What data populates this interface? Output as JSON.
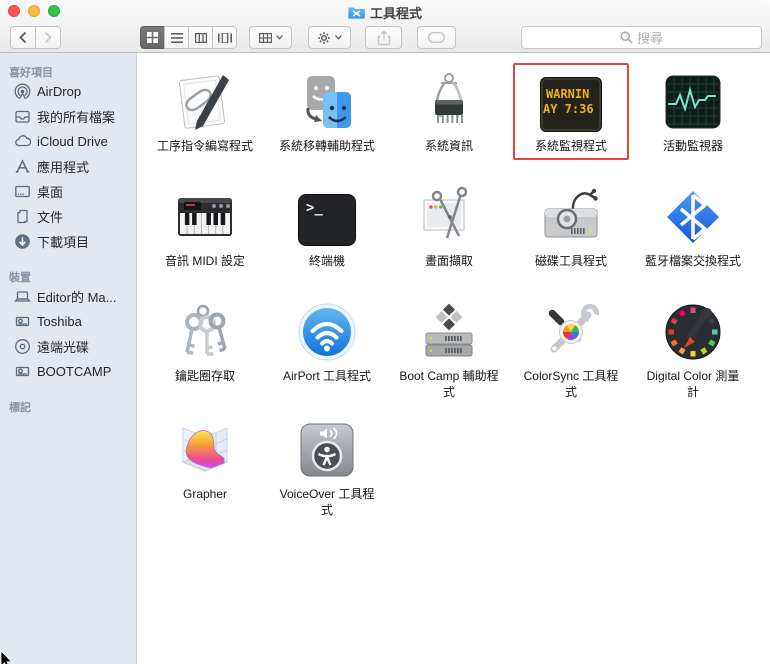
{
  "window": {
    "title": "工具程式"
  },
  "toolbar": {
    "search_placeholder": "搜尋",
    "icons": [
      "back-icon",
      "forward-icon",
      "icon-view-icon",
      "list-view-icon",
      "column-view-icon",
      "coverflow-view-icon",
      "arrange-icon",
      "gear-icon",
      "share-icon",
      "tag-icon",
      "search-icon"
    ]
  },
  "sidebar": {
    "sections": [
      {
        "header": "喜好項目",
        "items": [
          {
            "label": "AirDrop",
            "icon": "airdrop-icon"
          },
          {
            "label": "我的所有檔案",
            "icon": "all-files-icon"
          },
          {
            "label": "iCloud Drive",
            "icon": "icloud-icon"
          },
          {
            "label": "應用程式",
            "icon": "applications-icon"
          },
          {
            "label": "桌面",
            "icon": "desktop-icon"
          },
          {
            "label": "文件",
            "icon": "documents-icon"
          },
          {
            "label": "下載項目",
            "icon": "downloads-icon"
          }
        ]
      },
      {
        "header": "裝置",
        "items": [
          {
            "label": "Editor的 Ma...",
            "icon": "laptop-icon"
          },
          {
            "label": "Toshiba",
            "icon": "external-drive-icon"
          },
          {
            "label": "遠端光碟",
            "icon": "optical-disc-icon"
          },
          {
            "label": "BOOTCAMP",
            "icon": "external-drive-icon"
          }
        ]
      },
      {
        "header": "標記",
        "items": []
      }
    ]
  },
  "grid": {
    "items": [
      {
        "label": "工序指令編寫程式",
        "icon": "script-editor-icon"
      },
      {
        "label": "系統移轉輔助程式",
        "icon": "migration-assistant-icon"
      },
      {
        "label": "系統資訊",
        "icon": "system-information-icon"
      },
      {
        "label": "系統監視程式",
        "icon": "system-monitor-icon",
        "highlighted": true
      },
      {
        "label": "活動監視器",
        "icon": "activity-monitor-icon"
      },
      {
        "label": "音訊 MIDI 設定",
        "icon": "audio-midi-setup-icon"
      },
      {
        "label": "終端機",
        "icon": "terminal-icon"
      },
      {
        "label": "畫面擷取",
        "icon": "grab-icon"
      },
      {
        "label": "磁碟工具程式",
        "icon": "disk-utility-icon"
      },
      {
        "label": "藍牙檔案交換程式",
        "icon": "bluetooth-file-exchange-icon"
      },
      {
        "label": "鑰匙圈存取",
        "icon": "keychain-access-icon"
      },
      {
        "label": "AirPort 工具程式",
        "icon": "airport-utility-icon"
      },
      {
        "label": "Boot Camp 輔助程式",
        "icon": "boot-camp-assistant-icon"
      },
      {
        "label": "ColorSync 工具程式",
        "icon": "colorsync-utility-icon"
      },
      {
        "label": "Digital Color 測量計",
        "icon": "digital-color-meter-icon"
      },
      {
        "label": "Grapher",
        "icon": "grapher-icon"
      },
      {
        "label": "VoiceOver 工具程式",
        "icon": "voiceover-utility-icon"
      }
    ],
    "monitor_icon_text": {
      "line1": "WARNIN",
      "line2": "AY 7:36"
    },
    "terminal_prompt": ">_"
  },
  "colors": {
    "highlight_red": "#e8443c",
    "sidebar_bg": "#e2e7f0",
    "warning_amber": "#f0b400",
    "activity_green": "#86e0c8",
    "bluetooth_blue": "#2277ee"
  }
}
